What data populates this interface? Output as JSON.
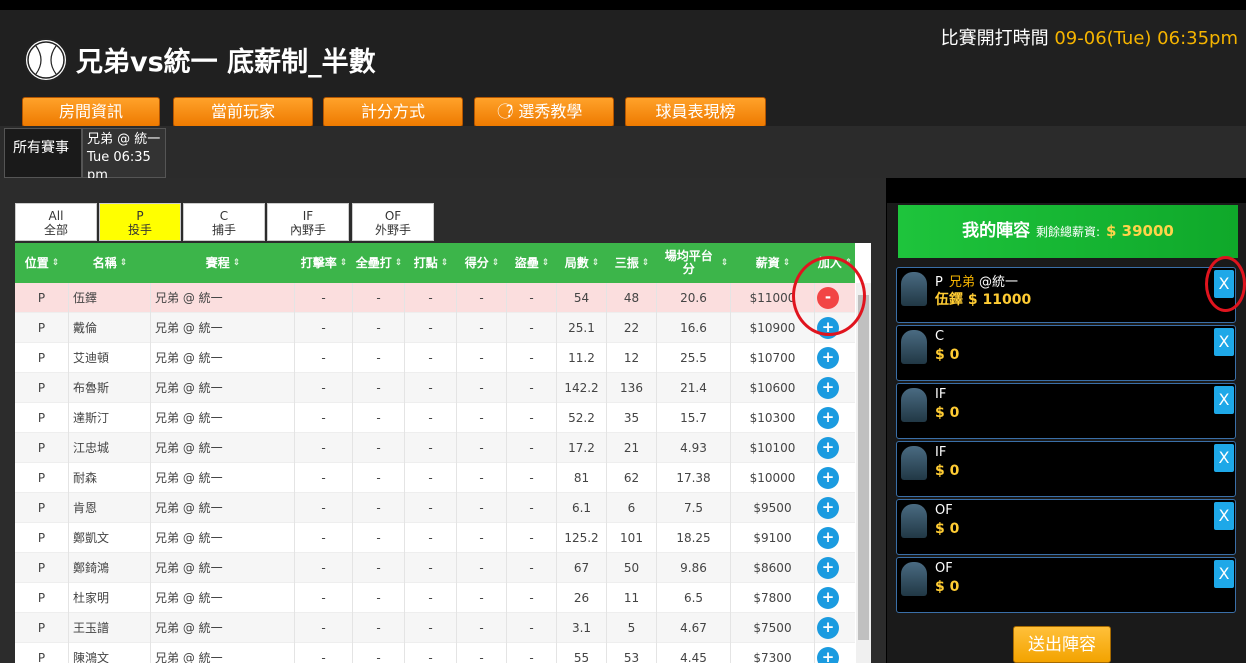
{
  "header": {
    "title": "兄弟vs統一 底薪制_半數",
    "start_label": "比賽開打時間",
    "start_value": "09-06(Tue) 06:35pm"
  },
  "nav": [
    "房間資訊",
    "當前玩家",
    "計分方式",
    "選秀教學",
    "球員表現榜"
  ],
  "tutorial_icon": "question-circle-icon",
  "matches": {
    "all_label": "所有賽事",
    "game_teams": "兄弟 @ 統一",
    "game_time": "Tue 06:35 pm"
  },
  "position_tabs": [
    {
      "code": "All",
      "label": "全部"
    },
    {
      "code": "P",
      "label": "投手"
    },
    {
      "code": "C",
      "label": "捕手"
    },
    {
      "code": "IF",
      "label": "內野手"
    },
    {
      "code": "OF",
      "label": "外野手"
    }
  ],
  "table": {
    "headers": [
      "位置",
      "名稱",
      "賽程",
      "打擊率",
      "全壘打",
      "打點",
      "得分",
      "盜壘",
      "局數",
      "三振",
      "場均平台分",
      "薪資",
      "加入"
    ],
    "rows": [
      {
        "pos": "P",
        "name": "伍鐸",
        "game": "兄弟 @ 統一",
        "avg": "-",
        "hr": "-",
        "rbi": "-",
        "r": "-",
        "sb": "-",
        "ip": "54",
        "so": "48",
        "fp": "20.6",
        "salary": "$11000",
        "action": "-"
      },
      {
        "pos": "P",
        "name": "戴倫",
        "game": "兄弟 @ 統一",
        "avg": "-",
        "hr": "-",
        "rbi": "-",
        "r": "-",
        "sb": "-",
        "ip": "25.1",
        "so": "22",
        "fp": "16.6",
        "salary": "$10900",
        "action": "+"
      },
      {
        "pos": "P",
        "name": "艾迪頓",
        "game": "兄弟 @ 統一",
        "avg": "-",
        "hr": "-",
        "rbi": "-",
        "r": "-",
        "sb": "-",
        "ip": "11.2",
        "so": "12",
        "fp": "25.5",
        "salary": "$10700",
        "action": "+"
      },
      {
        "pos": "P",
        "name": "布魯斯",
        "game": "兄弟 @ 統一",
        "avg": "-",
        "hr": "-",
        "rbi": "-",
        "r": "-",
        "sb": "-",
        "ip": "142.2",
        "so": "136",
        "fp": "21.4",
        "salary": "$10600",
        "action": "+"
      },
      {
        "pos": "P",
        "name": "達斯汀",
        "game": "兄弟 @ 統一",
        "avg": "-",
        "hr": "-",
        "rbi": "-",
        "r": "-",
        "sb": "-",
        "ip": "52.2",
        "so": "35",
        "fp": "15.7",
        "salary": "$10300",
        "action": "+"
      },
      {
        "pos": "P",
        "name": "江忠城",
        "game": "兄弟 @ 統一",
        "avg": "-",
        "hr": "-",
        "rbi": "-",
        "r": "-",
        "sb": "-",
        "ip": "17.2",
        "so": "21",
        "fp": "4.93",
        "salary": "$10100",
        "action": "+"
      },
      {
        "pos": "P",
        "name": "耐森",
        "game": "兄弟 @ 統一",
        "avg": "-",
        "hr": "-",
        "rbi": "-",
        "r": "-",
        "sb": "-",
        "ip": "81",
        "so": "62",
        "fp": "17.38",
        "salary": "$10000",
        "action": "+"
      },
      {
        "pos": "P",
        "name": "肯恩",
        "game": "兄弟 @ 統一",
        "avg": "-",
        "hr": "-",
        "rbi": "-",
        "r": "-",
        "sb": "-",
        "ip": "6.1",
        "so": "6",
        "fp": "7.5",
        "salary": "$9500",
        "action": "+"
      },
      {
        "pos": "P",
        "name": "鄭凱文",
        "game": "兄弟 @ 統一",
        "avg": "-",
        "hr": "-",
        "rbi": "-",
        "r": "-",
        "sb": "-",
        "ip": "125.2",
        "so": "101",
        "fp": "18.25",
        "salary": "$9100",
        "action": "+"
      },
      {
        "pos": "P",
        "name": "鄭錡鴻",
        "game": "兄弟 @ 統一",
        "avg": "-",
        "hr": "-",
        "rbi": "-",
        "r": "-",
        "sb": "-",
        "ip": "67",
        "so": "50",
        "fp": "9.86",
        "salary": "$8600",
        "action": "+"
      },
      {
        "pos": "P",
        "name": "杜家明",
        "game": "兄弟 @ 統一",
        "avg": "-",
        "hr": "-",
        "rbi": "-",
        "r": "-",
        "sb": "-",
        "ip": "26",
        "so": "11",
        "fp": "6.5",
        "salary": "$7800",
        "action": "+"
      },
      {
        "pos": "P",
        "name": "王玉譜",
        "game": "兄弟 @ 統一",
        "avg": "-",
        "hr": "-",
        "rbi": "-",
        "r": "-",
        "sb": "-",
        "ip": "3.1",
        "so": "5",
        "fp": "4.67",
        "salary": "$7500",
        "action": "+"
      },
      {
        "pos": "P",
        "name": "陳鴻文",
        "game": "兄弟 @ 統一",
        "avg": "-",
        "hr": "-",
        "rbi": "-",
        "r": "-",
        "sb": "-",
        "ip": "55",
        "so": "53",
        "fp": "4.45",
        "salary": "$7300",
        "action": "+"
      }
    ]
  },
  "lineup": {
    "title": "我的陣容",
    "remaining_label": "剩餘總薪資:",
    "remaining_value": "$ 39000",
    "slots": [
      {
        "pos": "P",
        "team": "兄弟",
        "vs": "@統一",
        "player": "伍鐸 $ 11000",
        "close": "X"
      },
      {
        "pos": "C",
        "team": "",
        "vs": "",
        "player": "$ 0",
        "close": "X"
      },
      {
        "pos": "IF",
        "team": "",
        "vs": "",
        "player": "$ 0",
        "close": "X"
      },
      {
        "pos": "IF",
        "team": "",
        "vs": "",
        "player": "$ 0",
        "close": "X"
      },
      {
        "pos": "OF",
        "team": "",
        "vs": "",
        "player": "$ 0",
        "close": "X"
      },
      {
        "pos": "OF",
        "team": "",
        "vs": "",
        "player": "$ 0",
        "close": "X"
      }
    ],
    "submit": "送出陣容"
  },
  "colors": {
    "accent_orange": "#ff8c00",
    "header_green": "#3cb54a",
    "highlight_yellow": "#ffff00",
    "add_blue": "#1a9be0",
    "remove_red": "#f24545"
  }
}
